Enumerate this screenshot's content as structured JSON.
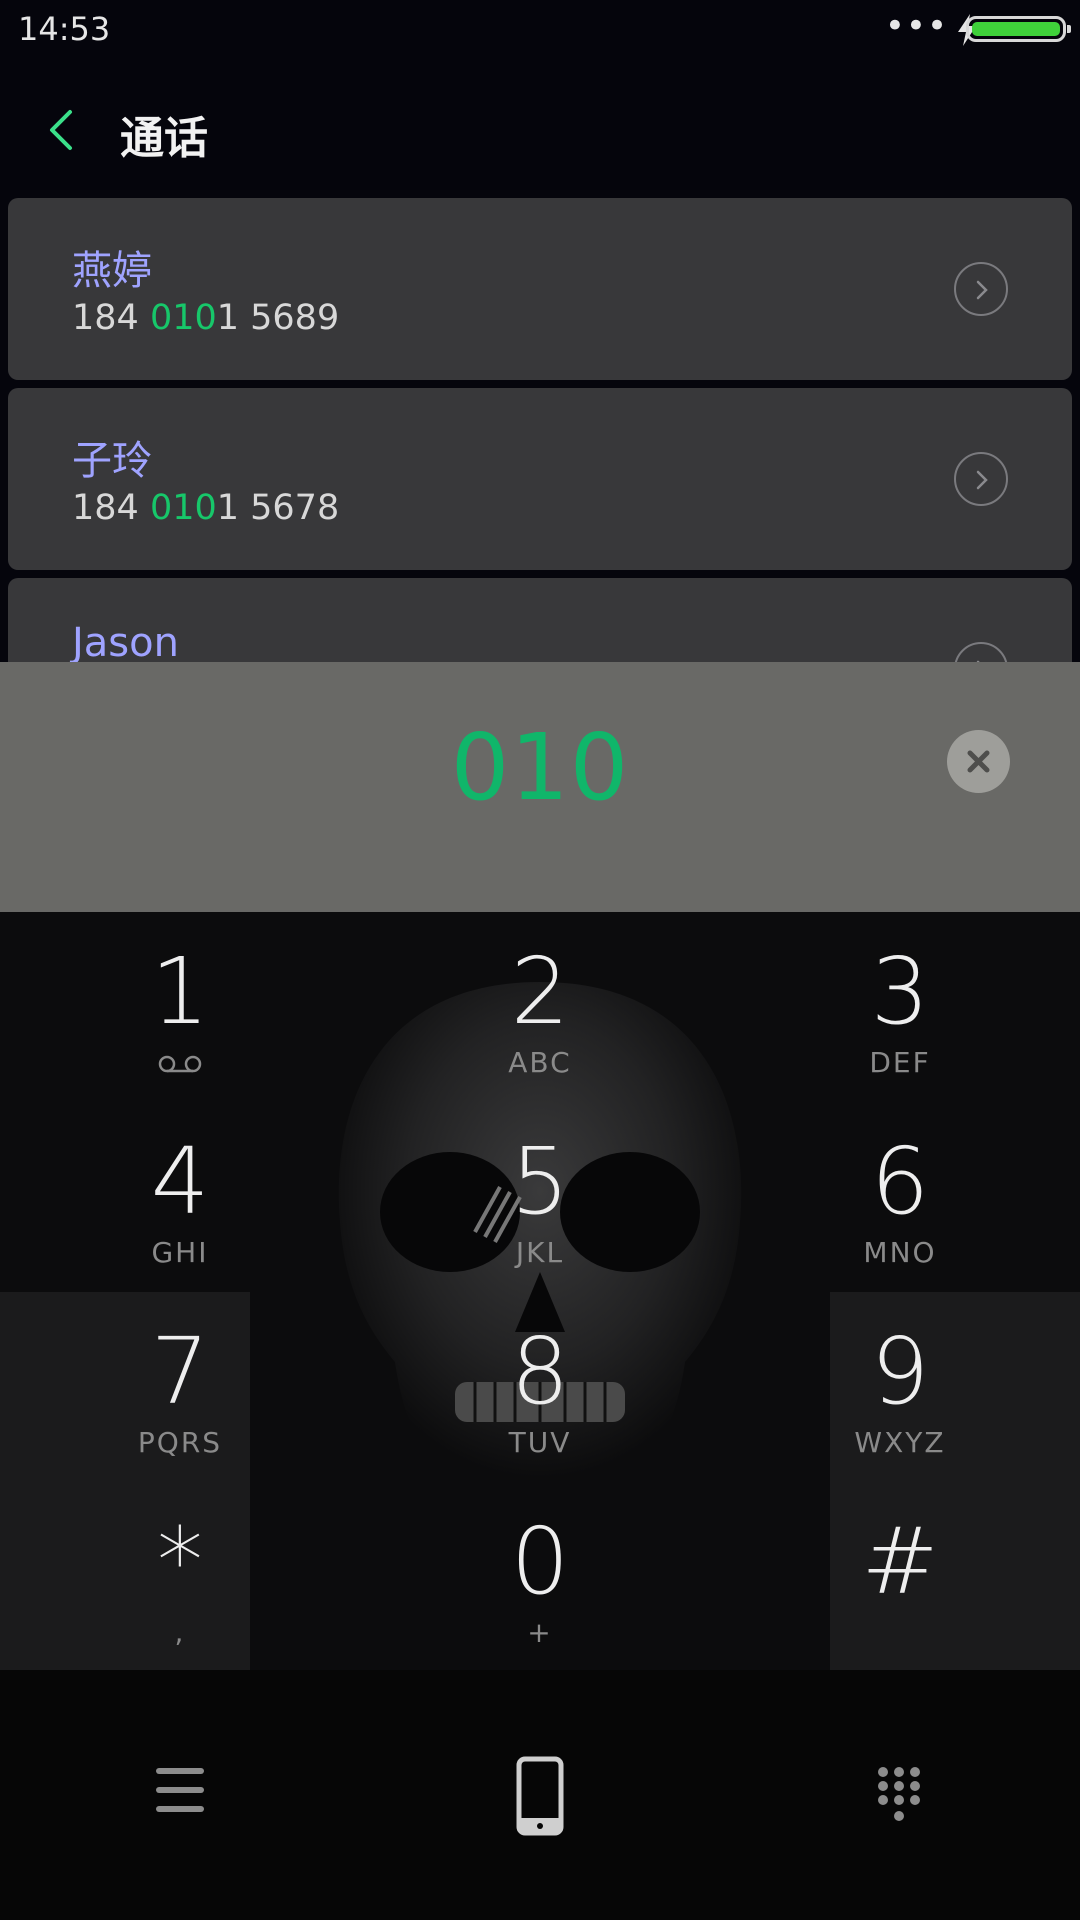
{
  "status_bar": {
    "time": "14:53",
    "dots": "•••",
    "battery_level": 1.0,
    "battery_color": "#3fd13a",
    "charging": true
  },
  "header": {
    "title": "通话",
    "back_icon": "chevron-left-icon",
    "accent": "#3be08a"
  },
  "contacts": [
    {
      "name": "燕婷",
      "number_prefix": "184 ",
      "number_match": "010",
      "number_suffix": "1 5689"
    },
    {
      "name": "子玲",
      "number_prefix": "184 ",
      "number_match": "010",
      "number_suffix": "1 5678"
    },
    {
      "name": "Jason"
    }
  ],
  "dialer": {
    "dialed_number": "010",
    "number_color": "#10b66a",
    "clear_icon": "close-icon"
  },
  "keypad": {
    "keys": [
      {
        "digit": "1",
        "letters": ""
      },
      {
        "digit": "2",
        "letters": "ABC"
      },
      {
        "digit": "3",
        "letters": "DEF"
      },
      {
        "digit": "4",
        "letters": "GHI"
      },
      {
        "digit": "5",
        "letters": "JKL"
      },
      {
        "digit": "6",
        "letters": "MNO"
      },
      {
        "digit": "7",
        "letters": "PQRS"
      },
      {
        "digit": "8",
        "letters": "TUV"
      },
      {
        "digit": "9",
        "letters": "WXYZ"
      },
      {
        "digit": "*",
        "letters": ","
      },
      {
        "digit": "0",
        "letters": "+"
      },
      {
        "digit": "#",
        "letters": ""
      }
    ]
  },
  "bottom_nav": {
    "items": [
      "menu-icon",
      "phone-icon",
      "keypad-icon"
    ]
  }
}
